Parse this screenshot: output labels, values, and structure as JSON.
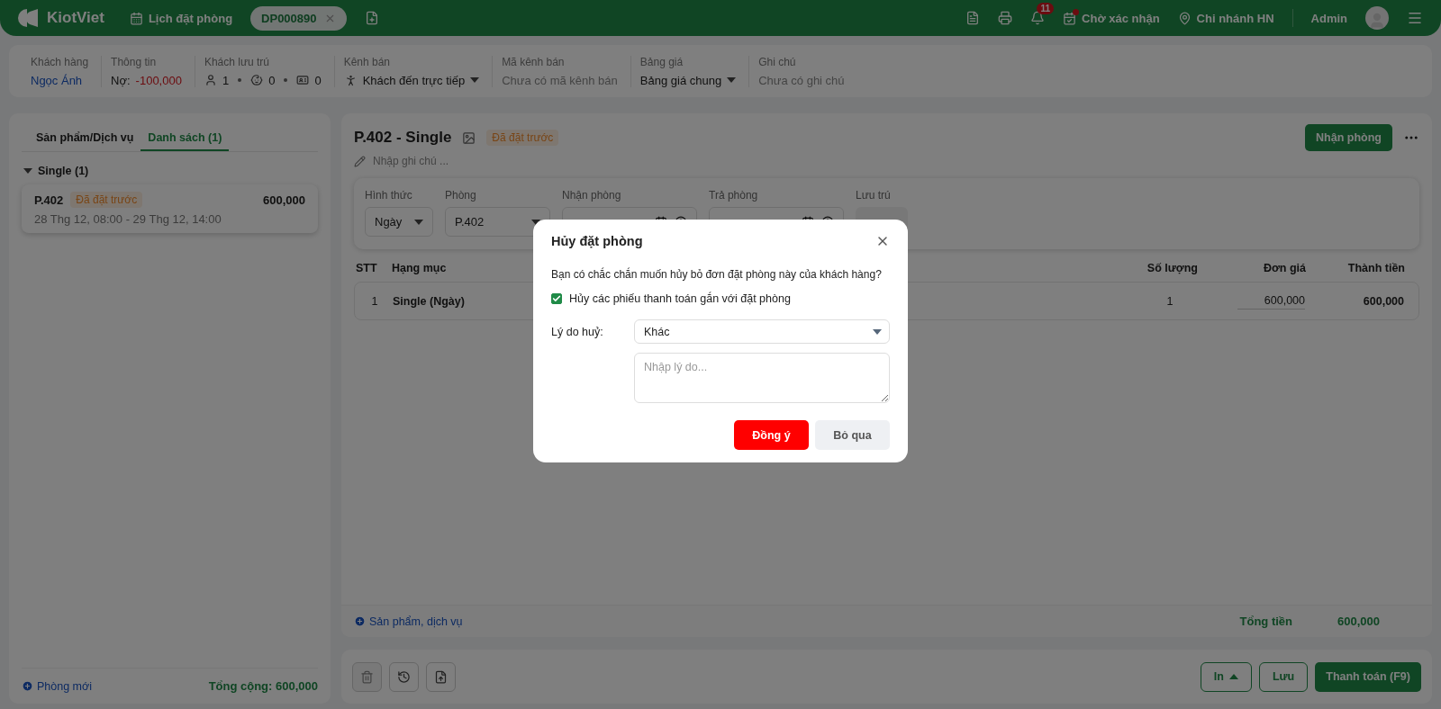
{
  "header": {
    "logo": "KiotViet",
    "nav_link": "Lịch đặt phòng",
    "open_tab": "DP000890",
    "notification_count": "11",
    "pending": "Chờ xác nhận",
    "branch": "Chi nhánh HN",
    "user": "Admin"
  },
  "info_bar": [
    {
      "label": "Khách hàng",
      "kind": "link",
      "value": "Ngọc Ánh"
    },
    {
      "label": "Thông tin",
      "kind": "debt",
      "prefix": "Nợ:",
      "value": "-100,000"
    },
    {
      "label": "Khách lưu trú",
      "kind": "guests",
      "counts": [
        "1",
        "0",
        "0"
      ]
    },
    {
      "label": "Kênh bán",
      "kind": "channel",
      "value": "Khách đến trực tiếp"
    },
    {
      "label": "Mã kênh bán",
      "kind": "empty",
      "value": "Chưa có mã kênh bán"
    },
    {
      "label": "Bảng giá",
      "kind": "select",
      "value": "Bảng giá chung"
    },
    {
      "label": "Ghi chú",
      "kind": "empty",
      "value": "Chưa có ghi chú"
    }
  ],
  "left_panel": {
    "tabs": [
      {
        "label": "Sản phẩm/Dịch vụ",
        "selected": false
      },
      {
        "label": "Danh sách (1)",
        "selected": true
      }
    ],
    "group": {
      "label": "Single (1)",
      "expanded": true
    },
    "rooms": [
      {
        "room": "P.402",
        "status": "Đã đặt trước",
        "amount": "600,000",
        "time": "28 Thg 12, 08:00 - 29 Thg 12, 14:00"
      }
    ],
    "new_room": "Phòng mới",
    "total": "Tổng cộng: 600,000"
  },
  "booking": {
    "title": "P.402 - Single",
    "status": "Đã đặt trước",
    "note_placeholder": "Nhập ghi chú ...",
    "checkin_button": "Nhận phòng",
    "fields": [
      {
        "label": "Hình thức",
        "kind": "select",
        "value": "Ngày"
      },
      {
        "label": "Phòng",
        "kind": "select",
        "value": "P.402"
      },
      {
        "label": "Nhận phòng",
        "kind": "datetime"
      },
      {
        "label": "Trả phòng",
        "kind": "datetime"
      },
      {
        "label": "Lưu trú",
        "kind": "readonly"
      }
    ],
    "columns": [
      "STT",
      "Hạng mục",
      "Số lượng",
      "Đơn giá",
      "Thành tiền"
    ],
    "rows": [
      {
        "stt": "1",
        "item": "Single (Ngày)",
        "quantity": "1",
        "unit_price": "600,000",
        "amount": "600,000"
      }
    ],
    "add_link": "Sản phẩm, dịch vụ",
    "total_label": "Tổng tiền",
    "total": "600,000"
  },
  "bottom_bar": {
    "print": "In",
    "save": "Lưu",
    "pay": "Thanh toán (F9)"
  },
  "dialog": {
    "title": "Hủy đặt phòng",
    "message": "Bạn có chắc chắn muốn hủy bỏ đơn đặt phòng này của khách hàng?",
    "checkbox": {
      "label": "Hủy các phiếu thanh toán gắn với đặt phòng",
      "checked": true
    },
    "reason_label": "Lý do huỷ:",
    "reason_value": "Khác",
    "reason_placeholder": "Nhập lý do...",
    "confirm": "Đồng ý",
    "cancel": "Bỏ qua"
  }
}
